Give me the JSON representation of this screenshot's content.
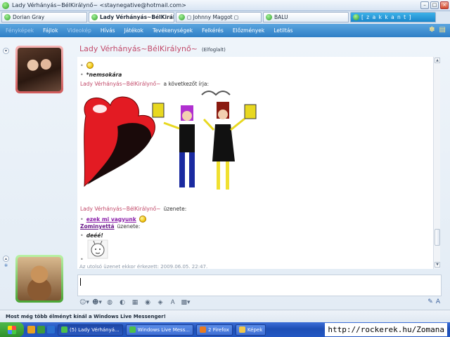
{
  "window": {
    "title": "Lady Vérhányás~BélKirálynő~ <staynegative@hotmail.com>",
    "buttons": [
      "–",
      "□",
      "×"
    ]
  },
  "tabs": [
    {
      "label": "Dorian Gray",
      "active": false
    },
    {
      "label": "Lady Vérhányás~BélKirálynő~",
      "active": true
    },
    {
      "label": "◻ Johnny  Maggot ◻",
      "active": false
    },
    {
      "label": "BALU",
      "active": false
    },
    {
      "label": "[ z a k k a n t ]",
      "active": false
    }
  ],
  "menu": {
    "items": [
      {
        "label": "Fényképek",
        "dim": true
      },
      {
        "label": "Fájlok",
        "dim": false
      },
      {
        "label": "Videokép",
        "dim": true
      },
      {
        "label": "Hívás",
        "dim": false
      },
      {
        "label": "Játékok",
        "dim": false
      },
      {
        "label": "Tevékenységek",
        "dim": false
      },
      {
        "label": "Felkérés",
        "dim": false
      },
      {
        "label": "Előzmények",
        "dim": false
      },
      {
        "label": "Letiltás",
        "dim": false
      }
    ]
  },
  "conversation": {
    "contact_name": "Lady Vérhányás~BélKirálynő~",
    "contact_status": "(Elfoglalt)",
    "messages": {
      "m1_text": "*nemsokára",
      "sender1": "Lady Vérhányás~BélKirálynő~",
      "writes": "a következőt írja:",
      "sender2": "Lady Vérhányás~BélKirálynő~",
      "message_label": "üzenete:",
      "m2_text": "ezek mi vagyunk",
      "sender3": "Zominyettá",
      "message_label2": "üzenete:",
      "m3_text": "deéé!"
    },
    "last_message": "Az utolsó üzenet ekkor érkezett: 2009.06.05. 22:47."
  },
  "promo": {
    "text": "Most még több élményt kínál a Windows Live Messenger!"
  },
  "taskbar": {
    "tasks": [
      {
        "label": "(5) Lady Vérhányá...",
        "active": true
      },
      {
        "label": "Windows Live Mess...",
        "active": false
      },
      {
        "label": "2 Firefox",
        "active": false
      },
      {
        "label": "Képek",
        "active": false
      }
    ],
    "watermark": "http://rockerek.hu/Zomana"
  },
  "colors": {
    "accent": "#2f7fc6",
    "sender": "#c24a6a",
    "contact_frame": "#d15b5b",
    "my_frame": "#4aa535"
  }
}
